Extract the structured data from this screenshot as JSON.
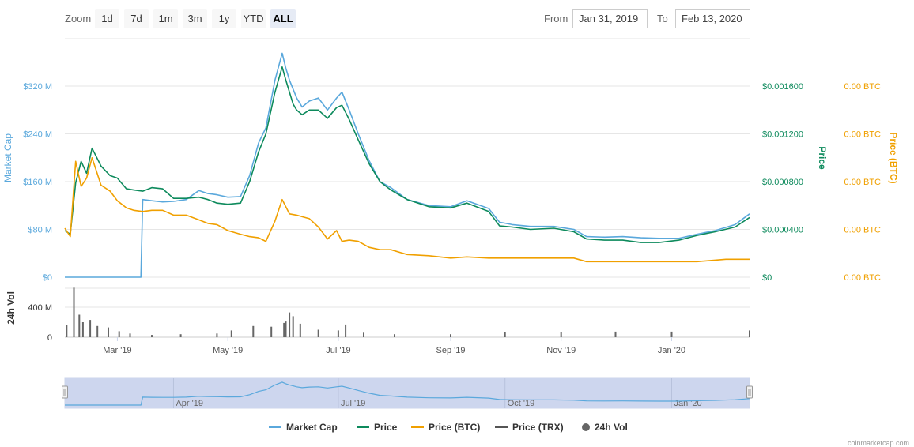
{
  "toolbar": {
    "zoom_label": "Zoom",
    "zoom_buttons": [
      "1d",
      "7d",
      "1m",
      "3m",
      "1y",
      "YTD",
      "ALL"
    ],
    "active_zoom": "ALL",
    "from_label": "From",
    "from_value": "Jan 31, 2019",
    "to_label": "To",
    "to_value": "Feb 13, 2020"
  },
  "legend": {
    "market_cap": "Market Cap",
    "price": "Price",
    "price_btc": "Price (BTC)",
    "price_trx": "Price (TRX)",
    "vol_24h": "24h Vol"
  },
  "credits": "coinmarketcap.com",
  "colors": {
    "market_cap": "#5aa8dc",
    "price": "#0d8a5c",
    "price_btc": "#f0a000",
    "price_trx": "#555555",
    "volume": "#666666",
    "navigator_fill": "#c8d2ec"
  },
  "chart_data": {
    "type": "line",
    "x_range": [
      "2019-01-31",
      "2020-02-13"
    ],
    "x_ticks": [
      "Mar '19",
      "May '19",
      "Jul '19",
      "Sep '19",
      "Nov '19",
      "Jan '20"
    ],
    "x_tick_dates": [
      "2019-03-01",
      "2019-05-01",
      "2019-07-01",
      "2019-09-01",
      "2019-11-01",
      "2020-01-01"
    ],
    "axes": {
      "market_cap": {
        "label": "Market Cap",
        "ticks": [
          "$0",
          "$80 M",
          "$160 M",
          "$240 M",
          "$320 M"
        ],
        "range": [
          0,
          320
        ],
        "unit": "M USD",
        "position": "left"
      },
      "price": {
        "label": "Price",
        "ticks": [
          "$0",
          "$0.000400",
          "$0.000800",
          "$0.001200",
          "$0.001600"
        ],
        "range": [
          0,
          0.0016
        ],
        "position": "right"
      },
      "price_btc": {
        "label": "Price (BTC)",
        "ticks": [
          "0.00 BTC",
          "0.00 BTC",
          "0.00 BTC",
          "0.00 BTC",
          "0.00 BTC"
        ],
        "position": "right"
      },
      "volume": {
        "label": "24h Vol",
        "ticks": [
          "0",
          "400 M"
        ],
        "range": [
          0,
          400
        ],
        "unit": "M USD",
        "position": "left"
      }
    },
    "navigator_ticks": [
      "Apr '19",
      "Jul '19",
      "Oct '19",
      "Jan '20"
    ],
    "navigator_tick_dates": [
      "2019-04-01",
      "2019-07-01",
      "2019-10-01",
      "2020-01-01"
    ],
    "series": [
      {
        "name": "Market Cap",
        "axis": "market_cap",
        "x": [
          "2019-01-31",
          "2019-02-05",
          "2019-02-08",
          "2019-02-12",
          "2019-02-15",
          "2019-02-20",
          "2019-02-25",
          "2019-03-01",
          "2019-03-06",
          "2019-03-10",
          "2019-03-13",
          "2019-03-14",
          "2019-03-15",
          "2019-03-20",
          "2019-03-26",
          "2019-04-01",
          "2019-04-08",
          "2019-04-15",
          "2019-04-20",
          "2019-04-25",
          "2019-05-01",
          "2019-05-08",
          "2019-05-13",
          "2019-05-18",
          "2019-05-22",
          "2019-05-27",
          "2019-05-31",
          "2019-06-02",
          "2019-06-04",
          "2019-06-06",
          "2019-06-08",
          "2019-06-11",
          "2019-06-15",
          "2019-06-20",
          "2019-06-25",
          "2019-06-30",
          "2019-07-03",
          "2019-07-07",
          "2019-07-12",
          "2019-07-18",
          "2019-07-24",
          "2019-07-30",
          "2019-08-08",
          "2019-08-20",
          "2019-09-01",
          "2019-09-10",
          "2019-09-22",
          "2019-09-28",
          "2019-10-05",
          "2019-10-15",
          "2019-10-28",
          "2019-11-08",
          "2019-11-15",
          "2019-11-25",
          "2019-12-05",
          "2019-12-15",
          "2019-12-25",
          "2020-01-05",
          "2020-01-15",
          "2020-01-25",
          "2020-02-05",
          "2020-02-13"
        ],
        "values": [
          0,
          0,
          0,
          0,
          0,
          0,
          0,
          0,
          0,
          0,
          0,
          0,
          130,
          128,
          126,
          127,
          130,
          145,
          140,
          138,
          134,
          135,
          170,
          225,
          250,
          330,
          375,
          350,
          330,
          315,
          300,
          285,
          295,
          300,
          280,
          300,
          310,
          280,
          240,
          195,
          160,
          150,
          130,
          120,
          118,
          128,
          115,
          92,
          88,
          85,
          85,
          80,
          68,
          67,
          68,
          66,
          65,
          65,
          72,
          78,
          88,
          106
        ]
      },
      {
        "name": "Price",
        "axis": "price",
        "x": [
          "2019-01-31",
          "2019-02-03",
          "2019-02-06",
          "2019-02-09",
          "2019-02-12",
          "2019-02-15",
          "2019-02-20",
          "2019-02-25",
          "2019-03-01",
          "2019-03-06",
          "2019-03-10",
          "2019-03-15",
          "2019-03-20",
          "2019-03-26",
          "2019-04-01",
          "2019-04-08",
          "2019-04-15",
          "2019-04-20",
          "2019-04-25",
          "2019-05-01",
          "2019-05-08",
          "2019-05-13",
          "2019-05-18",
          "2019-05-22",
          "2019-05-27",
          "2019-05-31",
          "2019-06-02",
          "2019-06-04",
          "2019-06-06",
          "2019-06-08",
          "2019-06-11",
          "2019-06-15",
          "2019-06-20",
          "2019-06-25",
          "2019-06-30",
          "2019-07-03",
          "2019-07-07",
          "2019-07-12",
          "2019-07-18",
          "2019-07-24",
          "2019-07-30",
          "2019-08-08",
          "2019-08-20",
          "2019-09-01",
          "2019-09-10",
          "2019-09-22",
          "2019-09-28",
          "2019-10-05",
          "2019-10-15",
          "2019-10-28",
          "2019-11-08",
          "2019-11-15",
          "2019-11-25",
          "2019-12-05",
          "2019-12-15",
          "2019-12-25",
          "2020-01-05",
          "2020-01-15",
          "2020-01-25",
          "2020-02-05",
          "2020-02-13"
        ],
        "values": [
          0.00039,
          0.00036,
          0.00079,
          0.00097,
          0.00087,
          0.00108,
          0.00093,
          0.00085,
          0.00083,
          0.00074,
          0.00073,
          0.00072,
          0.00075,
          0.00074,
          0.00066,
          0.00066,
          0.00067,
          0.00065,
          0.00062,
          0.00061,
          0.00062,
          0.0008,
          0.00105,
          0.0012,
          0.00155,
          0.00176,
          0.00165,
          0.00155,
          0.00145,
          0.0014,
          0.00136,
          0.0014,
          0.0014,
          0.00133,
          0.00142,
          0.00144,
          0.00132,
          0.00115,
          0.00095,
          0.0008,
          0.00073,
          0.00065,
          0.00059,
          0.00058,
          0.00062,
          0.00055,
          0.00043,
          0.00042,
          0.0004,
          0.00041,
          0.00038,
          0.00032,
          0.00031,
          0.00031,
          0.00029,
          0.00029,
          0.00031,
          0.00035,
          0.00038,
          0.00042,
          0.0005
        ]
      },
      {
        "name": "Price (BTC)",
        "axis": "price_btc",
        "x": [
          "2019-01-31",
          "2019-02-03",
          "2019-02-06",
          "2019-02-09",
          "2019-02-12",
          "2019-02-15",
          "2019-02-20",
          "2019-02-25",
          "2019-03-01",
          "2019-03-06",
          "2019-03-10",
          "2019-03-15",
          "2019-03-20",
          "2019-03-26",
          "2019-04-01",
          "2019-04-08",
          "2019-04-15",
          "2019-04-20",
          "2019-04-25",
          "2019-05-01",
          "2019-05-08",
          "2019-05-13",
          "2019-05-18",
          "2019-05-22",
          "2019-05-27",
          "2019-05-31",
          "2019-06-04",
          "2019-06-08",
          "2019-06-15",
          "2019-06-20",
          "2019-06-25",
          "2019-06-30",
          "2019-07-03",
          "2019-07-07",
          "2019-07-12",
          "2019-07-18",
          "2019-07-24",
          "2019-07-30",
          "2019-08-08",
          "2019-08-20",
          "2019-09-01",
          "2019-09-10",
          "2019-09-22",
          "2019-09-28",
          "2019-10-05",
          "2019-10-28",
          "2019-11-08",
          "2019-11-15",
          "2019-12-05",
          "2019-12-25",
          "2020-01-15",
          "2020-01-31",
          "2020-02-13"
        ],
        "values": [
          0.00041,
          0.00034,
          0.00097,
          0.00076,
          0.00083,
          0.001,
          0.00077,
          0.00072,
          0.00064,
          0.00058,
          0.00056,
          0.00055,
          0.00056,
          0.00056,
          0.00052,
          0.00052,
          0.00048,
          0.00045,
          0.00044,
          0.00039,
          0.00036,
          0.00034,
          0.00033,
          0.0003,
          0.00047,
          0.00065,
          0.00053,
          0.00052,
          0.00049,
          0.00042,
          0.00032,
          0.00039,
          0.0003,
          0.00031,
          0.0003,
          0.00025,
          0.00023,
          0.00023,
          0.00019,
          0.00018,
          0.00016,
          0.00017,
          0.00016,
          0.00016,
          0.00016,
          0.00016,
          0.00016,
          0.00013,
          0.00013,
          0.00013,
          0.00013,
          0.00015,
          0.00015
        ]
      },
      {
        "name": "24h Vol",
        "axis": "volume",
        "style": "columns",
        "x": [
          "2019-02-01",
          "2019-02-05",
          "2019-02-08",
          "2019-02-10",
          "2019-02-14",
          "2019-02-18",
          "2019-02-24",
          "2019-03-02",
          "2019-03-08",
          "2019-03-20",
          "2019-04-05",
          "2019-04-25",
          "2019-05-03",
          "2019-05-15",
          "2019-05-25",
          "2019-06-01",
          "2019-06-02",
          "2019-06-04",
          "2019-06-06",
          "2019-06-10",
          "2019-06-20",
          "2019-07-01",
          "2019-07-05",
          "2019-07-15",
          "2019-08-01",
          "2019-09-01",
          "2019-10-01",
          "2019-11-01",
          "2019-12-01",
          "2020-01-01",
          "2020-02-13"
        ],
        "values": [
          160,
          660,
          300,
          200,
          230,
          150,
          130,
          80,
          50,
          30,
          40,
          50,
          90,
          150,
          140,
          190,
          210,
          330,
          280,
          180,
          100,
          90,
          170,
          60,
          40,
          40,
          70,
          70,
          75,
          75,
          90
        ]
      }
    ]
  }
}
